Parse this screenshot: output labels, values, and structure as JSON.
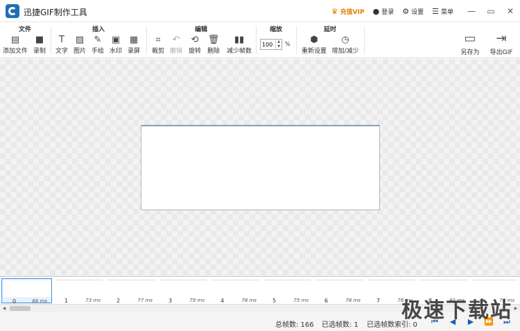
{
  "app": {
    "title": "迅捷GIF制作工具"
  },
  "title_bar": {
    "vip_label": "充值VIP",
    "login_label": "登录",
    "settings_label": "设置",
    "menu_label": "菜单"
  },
  "toolbar": {
    "file": {
      "title": "文件",
      "add_file": "添加文件",
      "record": "录制"
    },
    "insert": {
      "title": "插入",
      "text": "文字",
      "image": "图片",
      "draw": "手绘",
      "watermark": "水印",
      "screen_record": "录屏"
    },
    "edit": {
      "title": "编辑",
      "crop": "裁剪",
      "undo": "撤销",
      "rotate": "旋转",
      "delete": "删除",
      "reduce_frames": "减少帧数"
    },
    "zoom": {
      "title": "缩放",
      "value": "100",
      "unit": "%"
    },
    "delay": {
      "title": "延时",
      "reset": "重新设置",
      "increase_decrease": "增加/减少"
    },
    "save_as": "另存为",
    "export_gif": "导出GIF"
  },
  "filmstrip": {
    "frames": [
      {
        "index": "0",
        "duration": "66 ms"
      },
      {
        "index": "1",
        "duration": "73 ms"
      },
      {
        "index": "2",
        "duration": "77 ms"
      },
      {
        "index": "3",
        "duration": "79 ms"
      },
      {
        "index": "4",
        "duration": "78 ms"
      },
      {
        "index": "5",
        "duration": "75 ms"
      },
      {
        "index": "6",
        "duration": "78 ms"
      },
      {
        "index": "7",
        "duration": "76 ms"
      },
      {
        "index": "8",
        "duration": "81 ms"
      },
      {
        "index": "9",
        "duration": "76 ms"
      }
    ]
  },
  "status": {
    "total_frames": "总帧数: 166",
    "selected_frames": "已选帧数: 1",
    "selected_index": "已选帧数索引: 0"
  },
  "watermark_text": "极速下载站",
  "colors": {
    "accent": "#1f6fb8",
    "vip": "#e67e00",
    "selection": "#3c8ee0"
  }
}
